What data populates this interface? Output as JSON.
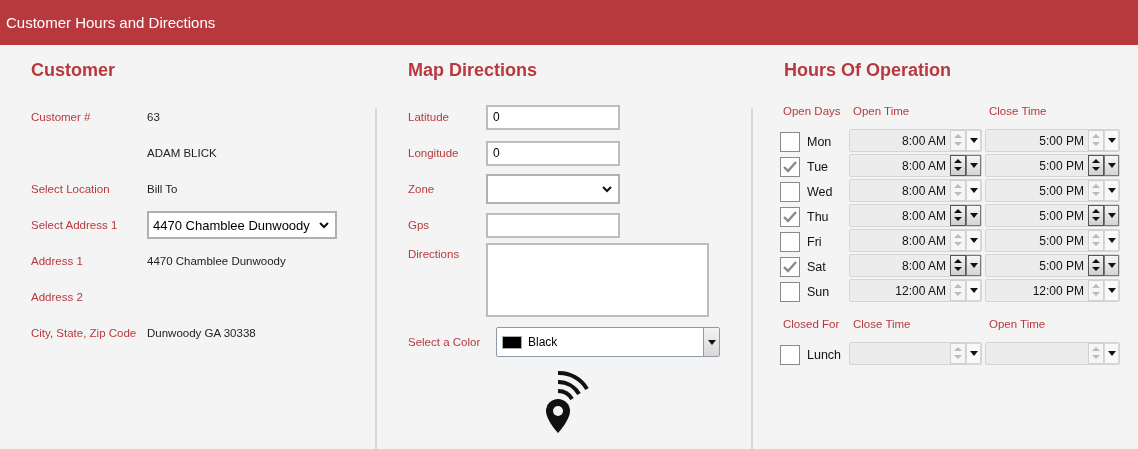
{
  "window": {
    "title": "Customer Hours and Directions"
  },
  "customer": {
    "title": "Customer",
    "fields": [
      {
        "label": "Customer #",
        "kind": "text",
        "value": "63"
      },
      {
        "kind": "text",
        "value": "ADAM BLICK"
      },
      {
        "label": "Select Location",
        "kind": "text",
        "value": "Bill To"
      },
      {
        "label": "Select Address 1",
        "kind": "select",
        "value": "4470 Chamblee Dunwoody"
      },
      {
        "label": "Address 1",
        "kind": "text",
        "value": "4470 Chamblee Dunwoody"
      },
      {
        "label": "Address 2",
        "kind": "text"
      },
      {
        "label": "City, State, Zip Code",
        "kind": "text",
        "value": "Dunwoody GA 30338"
      }
    ]
  },
  "map": {
    "title": "Map Directions",
    "fields": [
      {
        "label": "Latitude",
        "kind": "input",
        "value": "0"
      },
      {
        "label": "Longitude",
        "kind": "input",
        "value": "0"
      },
      {
        "label": "Zone",
        "kind": "select"
      },
      {
        "label": "Gps",
        "kind": "input"
      },
      {
        "label": "Directions",
        "kind": "textarea"
      }
    ],
    "color_select": {
      "label": "Select a Color",
      "value": "Black",
      "color": "#000000"
    }
  },
  "hours": {
    "title": "Hours Of Operation",
    "headers": [
      "Open Days",
      "Open Time",
      "Close Time"
    ],
    "days": [
      {
        "label": "Mon",
        "checked": false,
        "open": "8:00 AM",
        "close": "5:00 PM"
      },
      {
        "label": "Tue",
        "checked": true,
        "open": "8:00 AM",
        "close": "5:00 PM"
      },
      {
        "label": "Wed",
        "checked": false,
        "open": "8:00 AM",
        "close": "5:00 PM"
      },
      {
        "label": "Thu",
        "checked": true,
        "open": "8:00 AM",
        "close": "5:00 PM"
      },
      {
        "label": "Fri",
        "checked": false,
        "open": "8:00 AM",
        "close": "5:00 PM"
      },
      {
        "label": "Sat",
        "checked": true,
        "open": "8:00 AM",
        "close": "5:00 PM"
      },
      {
        "label": "Sun",
        "checked": false,
        "open": "12:00 AM",
        "close": "12:00 PM"
      }
    ],
    "closed_headers": [
      "Closed For",
      "Close Time",
      "Open Time"
    ],
    "closed": [
      {
        "label": "Lunch",
        "checked": false
      }
    ]
  }
}
